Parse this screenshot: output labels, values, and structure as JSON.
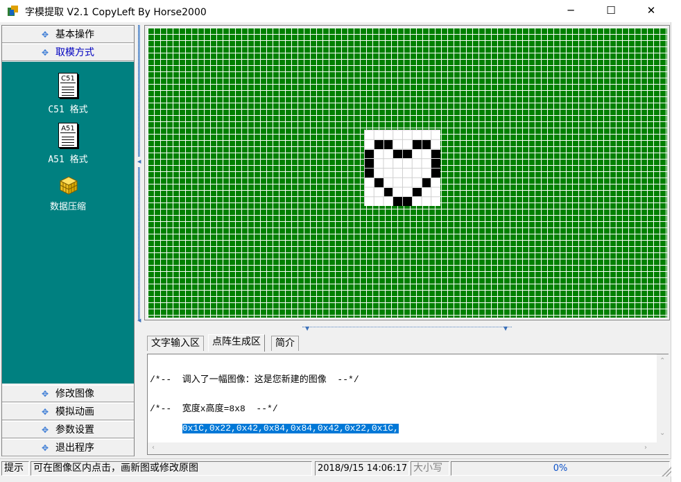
{
  "window": {
    "title": "字模提取 V2.1  CopyLeft By Horse2000",
    "min_glyph": "─",
    "max_glyph": "☐",
    "close_glyph": "✕"
  },
  "left_panel": {
    "top_groups": [
      {
        "label": "基本操作",
        "active": false
      },
      {
        "label": "取模方式",
        "active": true
      }
    ],
    "tools": [
      {
        "icon": "c51-document-icon",
        "icon_text": "C51",
        "label": "C51 格式"
      },
      {
        "icon": "a51-document-icon",
        "icon_text": "A51",
        "label": "A51 格式"
      },
      {
        "icon": "cube-icon",
        "label": "数据压缩"
      }
    ],
    "bottom_groups": [
      {
        "label": "修改图像"
      },
      {
        "label": "模拟动画"
      },
      {
        "label": "参数设置"
      },
      {
        "label": "退出程序"
      }
    ],
    "plus_glyph": "✥"
  },
  "canvas": {
    "background_color": "#008000",
    "grid_color": "#ffffff",
    "glyph_size": "8x8",
    "glyph_bytes": [
      "0x1C",
      "0x22",
      "0x42",
      "0x84",
      "0x84",
      "0x42",
      "0x22",
      "0x1C"
    ]
  },
  "tabs": [
    {
      "label": "文字输入区",
      "active": false
    },
    {
      "label": "点阵生成区",
      "active": true
    },
    {
      "label": "简介",
      "active": false
    }
  ],
  "output": {
    "line1": "/*--  调入了一幅图像：这是您新建的图像  --*/",
    "line2": "/*--  宽度x高度=8x8  --*/",
    "line3": "0x1C,0x22,0x42,0x84,0x84,0x42,0x22,0x1C,"
  },
  "statusbar": {
    "hint_label": "提示",
    "hint_text": "可在图像区内点击，画新图或修改原图",
    "datetime": "2018/9/15 14:06:17",
    "caps": "大小写",
    "progress": "0%"
  },
  "colors": {
    "teal_panel": "#008080",
    "selection": "#0078d7"
  }
}
